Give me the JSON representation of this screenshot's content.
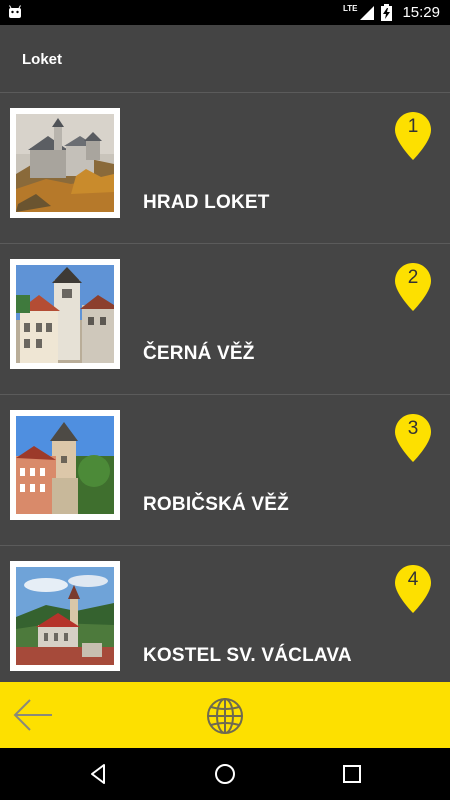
{
  "status_bar": {
    "network": "LTE",
    "time": "15:29",
    "icons": [
      "android-icon",
      "signal-icon",
      "battery-charging-icon"
    ]
  },
  "app_bar": {
    "title": "Loket"
  },
  "places": [
    {
      "number": "1",
      "name": "HRAD LOKET",
      "image": "castle-photo"
    },
    {
      "number": "2",
      "name": "ČERNÁ VĚŽ",
      "image": "black-tower-photo"
    },
    {
      "number": "3",
      "name": "ROBIČSKÁ VĚŽ",
      "image": "robic-tower-photo"
    },
    {
      "number": "4",
      "name": "KOSTEL SV. VÁCLAVA",
      "image": "church-photo"
    }
  ],
  "bottom_bar": {
    "icons": [
      "back-arrow-icon",
      "globe-icon"
    ]
  },
  "nav_bar": {
    "icons": [
      "back-triangle-icon",
      "home-circle-icon",
      "recents-square-icon"
    ]
  },
  "colors": {
    "accent": "#fde000",
    "background": "#454545",
    "pin": "#fde000"
  }
}
